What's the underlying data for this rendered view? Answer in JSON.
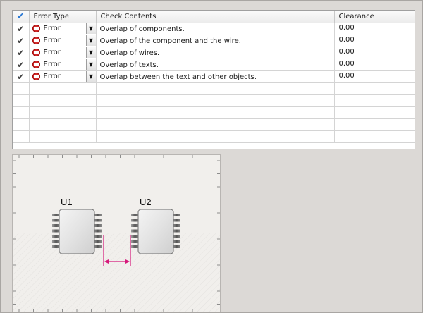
{
  "table": {
    "columns": {
      "check_icon": "checkmark-icon",
      "error_type": "Error Type",
      "check_contents": "Check Contents",
      "clearance": "Clearance"
    },
    "rows": [
      {
        "checked": true,
        "error_type": "Error",
        "check_contents": "Overlap of components.",
        "clearance": "0.00"
      },
      {
        "checked": true,
        "error_type": "Error",
        "check_contents": "Overlap of the component and the wire.",
        "clearance": "0.00"
      },
      {
        "checked": true,
        "error_type": "Error",
        "check_contents": "Overlap of wires.",
        "clearance": "0.00"
      },
      {
        "checked": true,
        "error_type": "Error",
        "check_contents": "Overlap of texts.",
        "clearance": "0.00"
      },
      {
        "checked": true,
        "error_type": "Error",
        "check_contents": "Overlap between the text and other objects.",
        "clearance": "0.00"
      }
    ],
    "empty_rows": 5
  },
  "preview": {
    "component_1": "U1",
    "component_2": "U2"
  },
  "colors": {
    "header_check": "#2a78d4",
    "error_icon": "#d42a2a",
    "dimension_line": "#d6197b"
  }
}
